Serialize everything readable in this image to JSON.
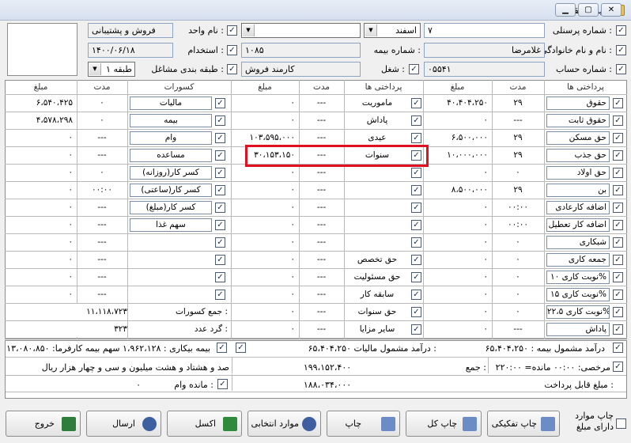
{
  "window": {
    "title": "فیش حقوقی",
    "min_glyph": "▁",
    "max_glyph": "▢",
    "close_glyph": "✕"
  },
  "check": "✓",
  "ellipsis": "...",
  "header": {
    "personnel_no_label": "شماره پرسنلی :",
    "personnel_no": "۷",
    "month": "اسفند",
    "year_value": "",
    "unit_label": "نام واحد :",
    "unit": "فروش و پشتیبانی",
    "fullname_label": "نام و نام خانوادگی :",
    "fullname": "غلامرضا",
    "insurance_no_label": "شماره بیمه :",
    "insurance_no": "۱۰۸۵",
    "hire_date_label": "استخدام :",
    "hire_date": "۱۴۰۰/۰۶/۱۸",
    "account_no_label": "شماره حساب :",
    "account_no": "۰۵۵۴۱",
    "job_label": "شغل :",
    "job": "کارمند فروش",
    "job_class_label": "طبقه بندی مشاغل :",
    "job_class": "طبقه ۱"
  },
  "columns": {
    "payments": "پرداختی ها",
    "days": "مدت",
    "amount": "مبلغ",
    "deductions": "کسورات"
  },
  "payments1": [
    {
      "label": "حقوق",
      "days": "۲۹",
      "amount": "۴۰،۴۰۴،۲۵۰"
    },
    {
      "label": "حقوق ثابت",
      "days": "---",
      "amount": "۰"
    },
    {
      "label": "حق مسکن",
      "days": "۲۹",
      "amount": "۶،۵۰۰،۰۰۰"
    },
    {
      "label": "حق جذب",
      "days": "۲۹",
      "amount": "۱۰،۰۰۰،۰۰۰"
    },
    {
      "label": "حق اولاد",
      "days": "۰",
      "amount": "۰"
    },
    {
      "label": "بن",
      "days": "۲۹",
      "amount": "۸،۵۰۰،۰۰۰"
    },
    {
      "label": "اضافه کارعادی",
      "days": "۰۰:۰۰",
      "amount": "۰"
    },
    {
      "label": "اضافه کار تعطیل",
      "days": "۰۰:۰۰",
      "amount": "۰"
    },
    {
      "label": "شبکاری",
      "days": "۰",
      "amount": "۰"
    },
    {
      "label": "جمعه کاری",
      "days": "۰",
      "amount": "۰"
    },
    {
      "label": "نوبت کاری ۱۰%",
      "days": "۰",
      "amount": "۰"
    },
    {
      "label": "نوبت کاری ۱۵%",
      "days": "۰",
      "amount": "۰"
    },
    {
      "label": "نوبت کاری ۲۲،۵%",
      "days": "۰",
      "amount": "۰"
    },
    {
      "label": "پاداش",
      "days": "---",
      "amount": "۰"
    }
  ],
  "payments2": [
    {
      "label": "ماموریت",
      "days": "---",
      "amount": "۰"
    },
    {
      "label": "پاداش",
      "days": "---",
      "amount": "۰"
    },
    {
      "label": "عیدی",
      "days": "---",
      "amount": "۱۰۳،۵۹۵،۰۰۰"
    },
    {
      "label": "سنوات",
      "days": "---",
      "amount": "۳۰،۱۵۳،۱۵۰"
    },
    {
      "label": "",
      "days": "---",
      "amount": "۰"
    },
    {
      "label": "",
      "days": "---",
      "amount": "۰"
    },
    {
      "label": "",
      "days": "---",
      "amount": "۰"
    },
    {
      "label": "",
      "days": "---",
      "amount": "۰"
    },
    {
      "label": "",
      "days": "---",
      "amount": "۰"
    },
    {
      "label": "حق تخصص",
      "days": "---",
      "amount": "۰"
    },
    {
      "label": "حق مسئولیت",
      "days": "---",
      "amount": "۰"
    },
    {
      "label": "سابقه کار",
      "days": "---",
      "amount": "۰"
    },
    {
      "label": "حق سنوات",
      "days": "---",
      "amount": "۰"
    },
    {
      "label": "سایر مزایا",
      "days": "---",
      "amount": "۰"
    }
  ],
  "deductions": [
    {
      "label": "مالیات",
      "days": "۰",
      "amount": "۶،۵۴۰،۴۲۵"
    },
    {
      "label": "بیمه",
      "days": "۰",
      "amount": "۴،۵۷۸،۲۹۸"
    },
    {
      "label": "وام",
      "days": "---",
      "amount": "۰"
    },
    {
      "label": "مساعده",
      "days": "---",
      "amount": "۰"
    },
    {
      "label": "کسر کار(روزانه)",
      "days": "۰",
      "amount": "۰"
    },
    {
      "label": "کسر کار(ساعتی)",
      "days": "۰۰:۰۰",
      "amount": "۰"
    },
    {
      "label": "کسر کار(مبلغ)",
      "days": "---",
      "amount": "۰"
    },
    {
      "label": "سهم غذا",
      "days": "---",
      "amount": "۰"
    },
    {
      "label": "",
      "days": "---",
      "amount": "۰"
    },
    {
      "label": "",
      "days": "---",
      "amount": "۰"
    },
    {
      "label": "",
      "days": "---",
      "amount": "۰"
    },
    {
      "label": "",
      "days": "---",
      "amount": "۰"
    }
  ],
  "totals": {
    "deductions_label": "جمع کسورات :",
    "deductions": "۱۱،۱۱۸،۷۲۳",
    "rounding_label": "گرد عدد :",
    "rounding": "۳۲۳"
  },
  "summary": {
    "taxable_text": "۶۵،۴۰۴،۲۵۰ درآمد مشمول مالیات :",
    "insurable_text": "درآمد مشمول بیمه : ۶۵،۴۰۴،۲۵۰",
    "unemployment_text": "بیمه بیکاری : ۱،۹۶۲،۱۲۸ سهم بیمه کارفرما: ۱۳،۰۸۰،۸۵۰",
    "leave_text": "مرخصی: ۰۰:۰۰ مانده= ۲۲۰:۰۰",
    "sum_label": "جمع :",
    "sum": "۱۹۹،۱۵۲،۴۰۰",
    "words": "صد و هشتاد و هشت میلیون و سی و چهار هزار ریال",
    "net_label": "مبلغ قابل پرداخت :",
    "net": "۱۸۸،۰۳۴،۰۰۰",
    "loan_balance_label": "مانده وام :",
    "loan_balance": "۰"
  },
  "buttons": {
    "print_by_amount": "چاپ موارد دارای مبلغ",
    "print_detail": "چاپ تفکیکی",
    "print_all": "چاپ کل",
    "print": "چاپ",
    "selected": "موارد انتخابی",
    "excel": "اکسل",
    "send": "ارسال",
    "exit": "خروج"
  }
}
